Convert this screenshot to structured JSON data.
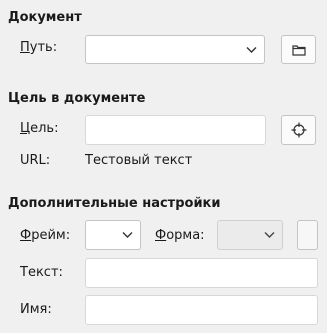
{
  "document": {
    "title": "Документ",
    "path_label_prefix": "П",
    "path_label_rest": "уть:",
    "path_value": ""
  },
  "target": {
    "title": "Цель в документе",
    "target_label_prefix": "Ц",
    "target_label_rest": "ель:",
    "target_value": "",
    "url_label": "URL:",
    "url_value": "Тестовый текст"
  },
  "advanced": {
    "title": "Дополнительные настройки",
    "frame_label_prefix": "Ф",
    "frame_label_rest": "рейм:",
    "frame_value": "",
    "form_label_prefix": "Ф",
    "form_label_rest": "орма:",
    "form_value": "",
    "text_label": "Текст:",
    "text_value": "",
    "name_label": "Имя:",
    "name_value": ""
  },
  "icons": {
    "path_combo_arrow": "chevron-down-icon",
    "browse_button": "folder-icon",
    "target_button": "crosshair-icon",
    "frame_combo_arrow": "chevron-down-icon",
    "form_combo_arrow": "chevron-down-icon"
  }
}
